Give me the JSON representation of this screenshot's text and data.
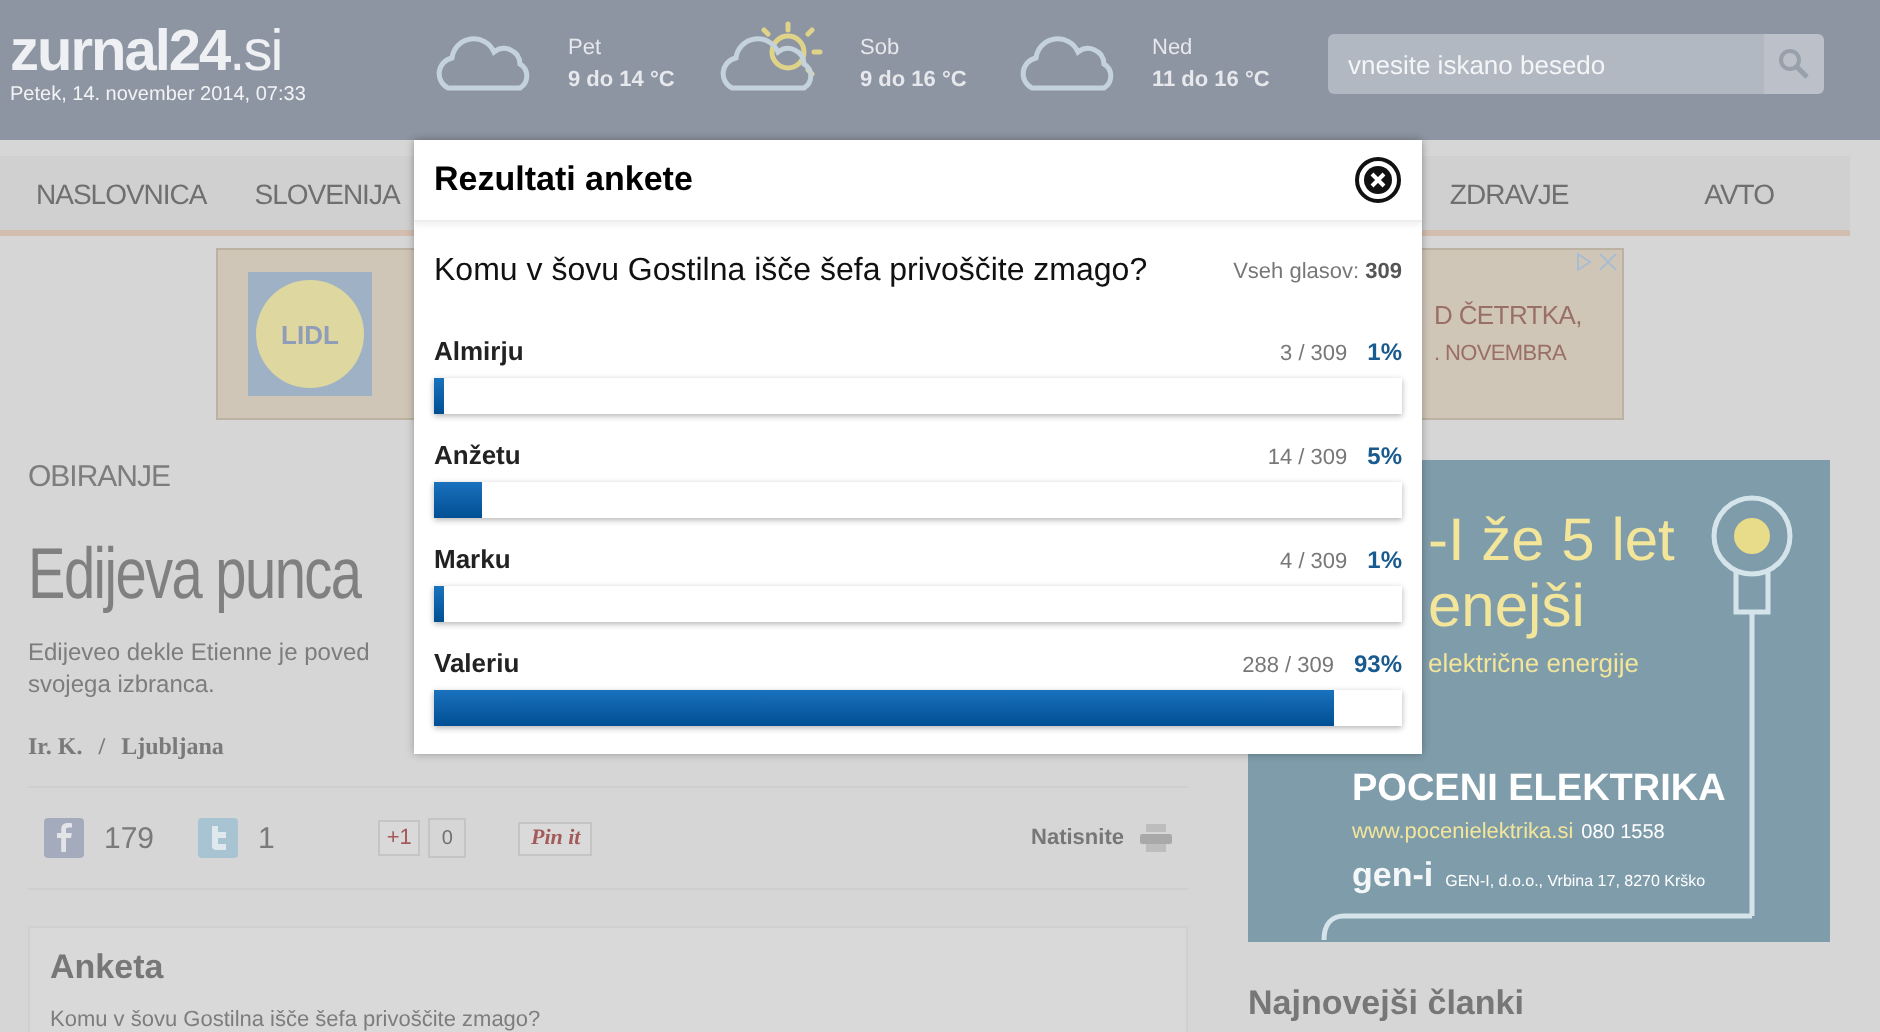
{
  "header": {
    "logo": "zurnal24",
    "logo_suffix": ".si",
    "date": "Petek, 14. november 2014, 07:33",
    "weather": [
      {
        "kind": "cloud",
        "day": "Pet",
        "temps": "9 do 14 °C"
      },
      {
        "kind": "sun-cloud",
        "day": "Sob",
        "temps": "9 do 16 °C"
      },
      {
        "kind": "cloud",
        "day": "Ned",
        "temps": "11 do 16 °C"
      }
    ],
    "search": {
      "placeholder": "vnesite iskano besedo"
    }
  },
  "nav": {
    "left": [
      "NASLOVNICA",
      "SLOVENIJA"
    ],
    "right": [
      "ZDRAVJE",
      "AVTO"
    ]
  },
  "banner_ad": {
    "logo": "LIDL",
    "lines": [
      "D ČETRTKA,",
      ". NOVEMBRA"
    ]
  },
  "article": {
    "category": "OBIRANJE",
    "title": "Edijeva punca",
    "lead_lines": [
      "Edijeveo dekle Etienne je poved",
      "svojega izbranca."
    ],
    "author": "Ir. K.",
    "byline_separator": "/",
    "location": "Ljubljana",
    "social": {
      "facebook_count": "179",
      "twitter_count": "1",
      "gplus_label": "+1",
      "gplus_count": "0",
      "pin_label": "Pin it",
      "print_label": "Natisnite"
    }
  },
  "poll_widget": {
    "title": "Anketa",
    "question": "Komu v šovu Gostilna išče šefa privoščite zmago?"
  },
  "sidebar": {
    "ad": {
      "lines": [
        "-I že 5 let",
        "enejši",
        "električne energije"
      ],
      "headline": "POCENI ELEKTRIKA",
      "url": "www.pocenielektrika.si",
      "phone": "080 1558",
      "brand": "gen-i",
      "address": "GEN-I, d.o.o., Vrbina 17, 8270 Krško"
    },
    "latest_heading": "Najnovejši članki"
  },
  "modal": {
    "title": "Rezultati ankete",
    "question": "Komu v šovu Gostilna išče šefa privoščite zmago?",
    "total_label": "Vseh glasov:",
    "total": "309",
    "options": [
      {
        "label": "Almirju",
        "count": "3 / 309",
        "percent": "1%",
        "level": 0.01
      },
      {
        "label": "Anžetu",
        "count": "14 / 309",
        "percent": "5%",
        "level": 0.05
      },
      {
        "label": "Marku",
        "count": "4 / 309",
        "percent": "1%",
        "level": 0.01
      },
      {
        "label": "Valeriu",
        "count": "288 / 309",
        "percent": "93%",
        "level": 0.93
      }
    ]
  }
}
